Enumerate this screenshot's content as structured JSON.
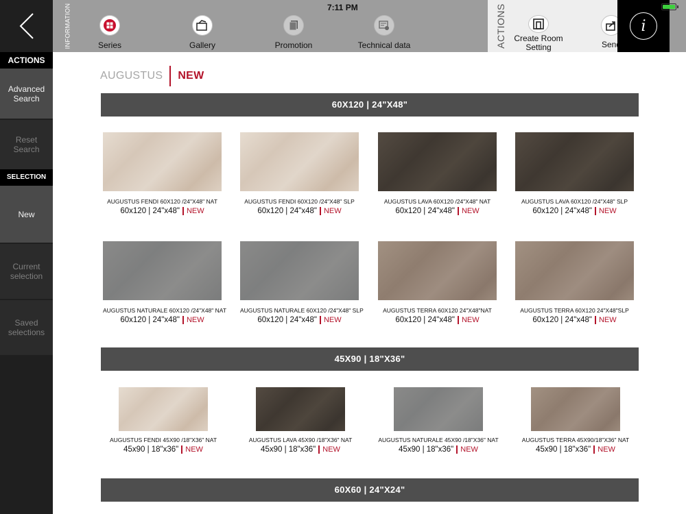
{
  "sidebar": {
    "actions_header": "ACTIONS",
    "advanced_search": "Advanced Search",
    "reset_search": "Reset Search",
    "selection_header": "SELECTION",
    "new": "New",
    "current_selection": "Current selection",
    "saved_selections": "Saved selections"
  },
  "topbar": {
    "information_label": "INFORMATION",
    "time": "7:11 PM",
    "series": "Series",
    "gallery": "Gallery",
    "promotion": "Promotion",
    "technical_data": "Technical data",
    "actions_label": "ACTIONS",
    "create_room_setting": "Create Room Setting",
    "send": "Send",
    "info": "i"
  },
  "breadcrumb": {
    "series": "AUGUSTUS",
    "filter": "NEW"
  },
  "colors": {
    "accent": "#b3132a",
    "sidebar_bg": "#1f1f1f",
    "topbar_bg": "#9d9d9d",
    "section_bar": "#4e4e4e"
  },
  "sections": [
    {
      "title": "60X120 | 24\"X48\"",
      "products": [
        {
          "name": "AUGUSTUS FENDI 60X120  /24\"X48\" NAT",
          "size": "60x120 | 24\"x48\"",
          "tag": "NEW",
          "color": "fendi"
        },
        {
          "name": "AUGUSTUS FENDI 60X120  /24\"X48\" SLP",
          "size": "60x120 | 24\"x48\"",
          "tag": "NEW",
          "color": "fendi"
        },
        {
          "name": "AUGUSTUS LAVA 60X120 /24\"X48\" NAT",
          "size": "60x120 | 24\"x48\"",
          "tag": "NEW",
          "color": "lava"
        },
        {
          "name": "AUGUSTUS LAVA 60X120 /24\"X48\" SLP",
          "size": "60x120 | 24\"x48\"",
          "tag": "NEW",
          "color": "lava"
        },
        {
          "name": "AUGUSTUS NATURALE 60X120  /24\"X48\" NAT",
          "size": "60x120 | 24\"x48\"",
          "tag": "NEW",
          "color": "naturale"
        },
        {
          "name": "AUGUSTUS NATURALE 60X120  /24\"X48\" SLP",
          "size": "60x120 | 24\"x48\"",
          "tag": "NEW",
          "color": "naturale"
        },
        {
          "name": "AUGUSTUS TERRA 60X120 24\"X48\"NAT",
          "size": "60x120 | 24\"x48\"",
          "tag": "NEW",
          "color": "terra"
        },
        {
          "name": "AUGUSTUS TERRA 60X120 24\"X48\"SLP",
          "size": "60x120 | 24\"x48\"",
          "tag": "NEW",
          "color": "terra"
        }
      ]
    },
    {
      "title": "45X90 | 18\"X36\"",
      "products": [
        {
          "name": "AUGUSTUS FENDI 45X90  /18\"X36\" NAT",
          "size": "45x90 | 18\"x36\"",
          "tag": "NEW",
          "color": "fendi"
        },
        {
          "name": "AUGUSTUS LAVA 45X90  /18\"X36\" NAT",
          "size": "45x90 | 18\"x36\"",
          "tag": "NEW",
          "color": "lava"
        },
        {
          "name": "AUGUSTUS NATURALE 45X90  /18\"X36\" NAT",
          "size": "45x90 | 18\"x36\"",
          "tag": "NEW",
          "color": "naturale"
        },
        {
          "name": "AUGUSTUS TERRA 45X90/18\"X36\" NAT",
          "size": "45x90 | 18\"x36\"",
          "tag": "NEW",
          "color": "terra"
        }
      ]
    },
    {
      "title": "60X60 | 24\"X24\"",
      "products": []
    }
  ]
}
